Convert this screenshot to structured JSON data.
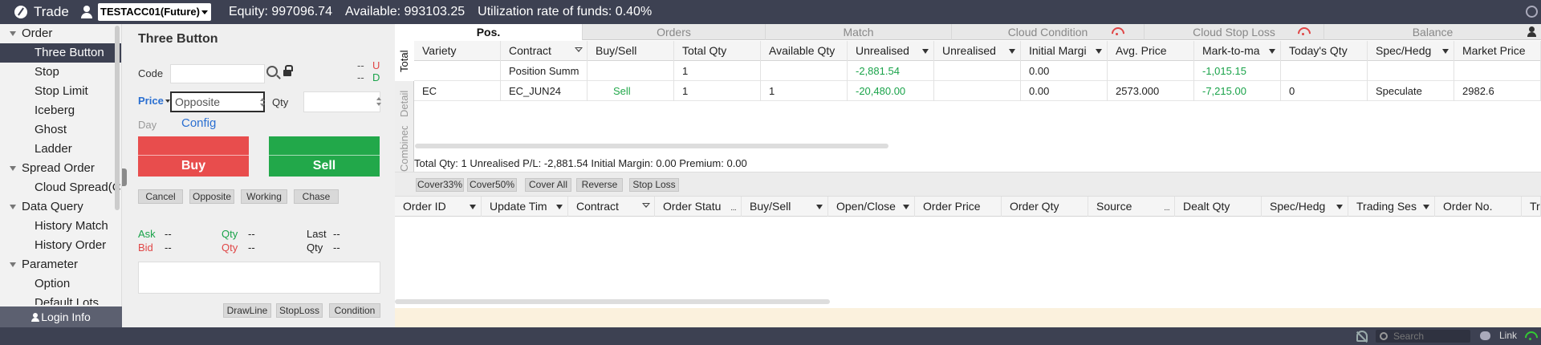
{
  "topbar": {
    "app_title": "Trade",
    "account": "TESTACC01(Future)",
    "equity": "Equity: 997096.74",
    "available": "Available: 993103.25",
    "utilization": "Utilization rate of funds: 0.40%"
  },
  "nav": {
    "items": [
      {
        "label": "Order",
        "type": "group"
      },
      {
        "label": "Three Button",
        "type": "child",
        "active": true
      },
      {
        "label": "Stop",
        "type": "child"
      },
      {
        "label": "Stop Limit",
        "type": "child"
      },
      {
        "label": "Iceberg",
        "type": "child"
      },
      {
        "label": "Ghost",
        "type": "child"
      },
      {
        "label": "Ladder",
        "type": "child"
      },
      {
        "label": "Spread Order",
        "type": "group"
      },
      {
        "label": "Cloud Spread(C",
        "type": "child"
      },
      {
        "label": "Data Query",
        "type": "group"
      },
      {
        "label": "History Match",
        "type": "child"
      },
      {
        "label": "History Order",
        "type": "child"
      },
      {
        "label": "Parameter",
        "type": "group"
      },
      {
        "label": "Option",
        "type": "child"
      },
      {
        "label": "Default Lots",
        "type": "child"
      }
    ],
    "login_info": "Login Info"
  },
  "entry": {
    "title": "Three Button",
    "code_label": "Code",
    "code_value": "",
    "up_dash": "--",
    "up_letter": "U",
    "down_dash": "--",
    "down_letter": "D",
    "price_label": "Price",
    "price_value": "Opposite",
    "qty_label": "Qty",
    "qty_value": "",
    "day_label": "Day",
    "config_label": "Config",
    "buy_label": "Buy",
    "sell_label": "Sell",
    "buttons": [
      "Cancel",
      "Opposite",
      "Working",
      "Chase"
    ],
    "quote": {
      "ask_label": "Ask",
      "ask_value": "--",
      "ask_qty_label": "Qty",
      "ask_qty_value": "--",
      "last_label": "Last",
      "last_value": "--",
      "bid_label": "Bid",
      "bid_value": "--",
      "bid_qty_label": "Qty",
      "bid_qty_value": "--",
      "qty_label": "Qty",
      "qty_value": "--"
    },
    "bottom_buttons": [
      "DrawLine",
      "StopLoss",
      "Condition"
    ]
  },
  "tabs": [
    {
      "label": "Pos.",
      "active": true
    },
    {
      "label": "Orders",
      "active": false
    },
    {
      "label": "Match",
      "active": false
    },
    {
      "label": "Cloud Condition",
      "active": false,
      "icon": "wifi-red-icon"
    },
    {
      "label": "Cloud Stop Loss",
      "active": false,
      "icon": "wifi-red-icon"
    },
    {
      "label": "Balance",
      "active": false
    }
  ],
  "positions": {
    "side_tabs": [
      "Total",
      "Detail",
      "Combined Detail"
    ],
    "columns": [
      "Variety",
      "Contract",
      "Buy/Sell",
      "Total Qty",
      "Available Qty",
      "Unrealised",
      "Unrealised",
      "Initial Margi",
      "Avg. Price",
      "Mark-to-ma",
      "Today's Qty",
      "Spec/Hedg",
      "Market Price"
    ],
    "rows": [
      [
        "",
        "Position Summ",
        "",
        "1",
        "",
        "-2,881.54",
        "",
        "0.00",
        "",
        "-1,015.15",
        "",
        "",
        ""
      ],
      [
        "EC",
        "EC_JUN24",
        "Sell",
        "1",
        "1",
        "-20,480.00",
        "",
        "0.00",
        "2573.000",
        "-7,215.00",
        "0",
        "Speculate",
        "2982.6"
      ]
    ],
    "summary": "Total Qty: 1  Unrealised P/L: -2,881.54  Initial Margin: 0.00  Premium: 0.00"
  },
  "actions": [
    "Cover33%",
    "Cover50%",
    "Cover All",
    "Reverse",
    "Stop Loss"
  ],
  "orders": {
    "columns": [
      "Order ID",
      "Update Tim",
      "Contract",
      "Order Statu",
      "Buy/Sell",
      "Open/Close",
      "Order Price",
      "Order Qty",
      "Source",
      "Dealt Qty",
      "Spec/Hedg",
      "Trading Ses",
      "Order No.",
      "Trad"
    ]
  },
  "statusbar": {
    "search_placeholder": "Search",
    "link_label": "Link"
  },
  "colors": {
    "dark_bar": "#3d4152",
    "buy": "#e84d4d",
    "sell": "#22a84a",
    "link": "#2a6fd1",
    "negative": "#1aa34a"
  }
}
